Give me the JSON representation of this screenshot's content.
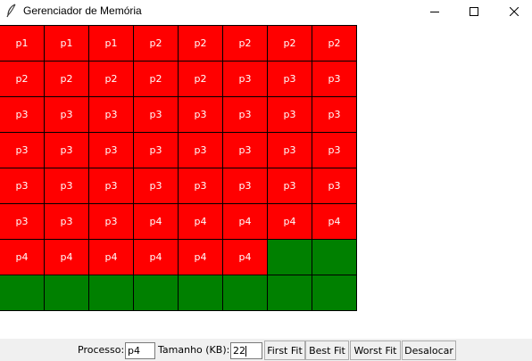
{
  "window": {
    "title": "Gerenciador de Memória"
  },
  "colors": {
    "allocated": "#ff0000",
    "free": "#008000"
  },
  "memory": {
    "cells": [
      "p1",
      "p1",
      "p1",
      "p2",
      "p2",
      "p2",
      "p2",
      "p2",
      "p2",
      "p2",
      "p2",
      "p2",
      "p2",
      "p3",
      "p3",
      "p3",
      "p3",
      "p3",
      "p3",
      "p3",
      "p3",
      "p3",
      "p3",
      "p3",
      "p3",
      "p3",
      "p3",
      "p3",
      "p3",
      "p3",
      "p3",
      "p3",
      "p3",
      "p3",
      "p3",
      "p3",
      "p3",
      "p3",
      "p3",
      "p3",
      "p3",
      "p3",
      "p3",
      "p4",
      "p4",
      "p4",
      "p4",
      "p4",
      "p4",
      "p4",
      "p4",
      "p4",
      "p4",
      "p4",
      "",
      "",
      "",
      "",
      "",
      "",
      "",
      "",
      "",
      ""
    ]
  },
  "controls": {
    "process_label": "Processo:",
    "process_value": "p4",
    "size_label": "Tamanho (KB):",
    "size_value": "22",
    "first_fit": "First Fit",
    "best_fit": "Best Fit",
    "worst_fit": "Worst Fit",
    "deallocate": "Desalocar"
  }
}
